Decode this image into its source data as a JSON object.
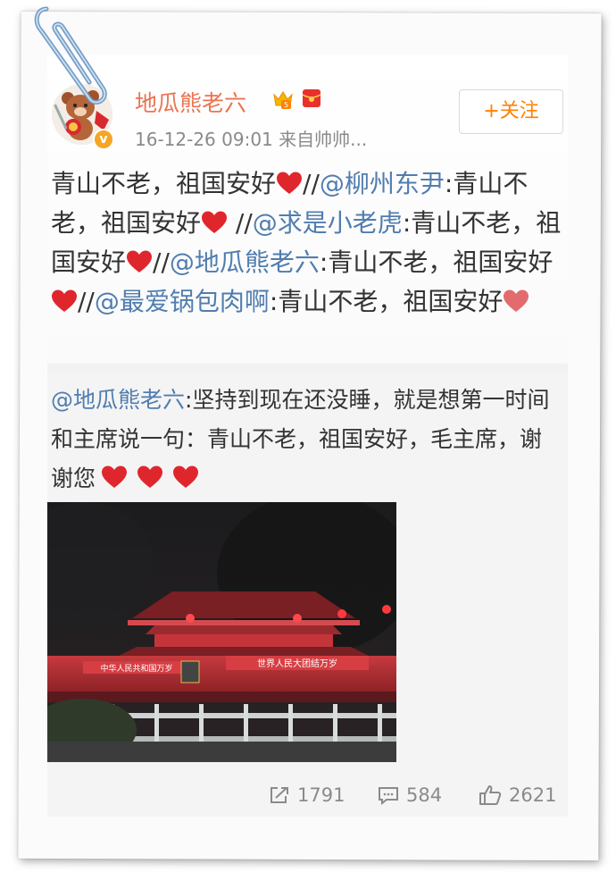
{
  "user": {
    "name": "地瓜熊老六",
    "time": "16-12-26 09:01",
    "source_prefix": "来自",
    "source_name": "帅帅..."
  },
  "follow": {
    "label": "+关注"
  },
  "post": {
    "seg1": "青山不老，祖国安好",
    "sep1": "//",
    "m1": "@柳州东尹",
    "seg2": ":青山不老，祖国安好",
    "sep2": " //",
    "m2": "@求是小老虎",
    "seg3": ":青山不老，祖国安好",
    "sep3": "//",
    "m3": "@地瓜熊老六",
    "seg4": ":青山不老，祖国安好",
    "sep4": "//",
    "m4": "@最爱锅包肉啊",
    "seg5": ":青山不老，祖国安好"
  },
  "quote": {
    "mention": "@地瓜熊老六",
    "text": ":坚持到现在还没睡，就是想第一时间和主席说一句：青山不老，祖国安好，毛主席，谢谢您"
  },
  "photo": {
    "left_banner": "中华人民共和国万岁",
    "right_banner": "世界人民大团结万岁"
  },
  "stats": {
    "reposts": "1791",
    "comments": "584",
    "likes": "2621"
  },
  "colors": {
    "username": "#eb7350",
    "mention": "#507daf",
    "follow": "#ff8200",
    "heart": "#e0262d",
    "meta": "#8a8a8a"
  }
}
